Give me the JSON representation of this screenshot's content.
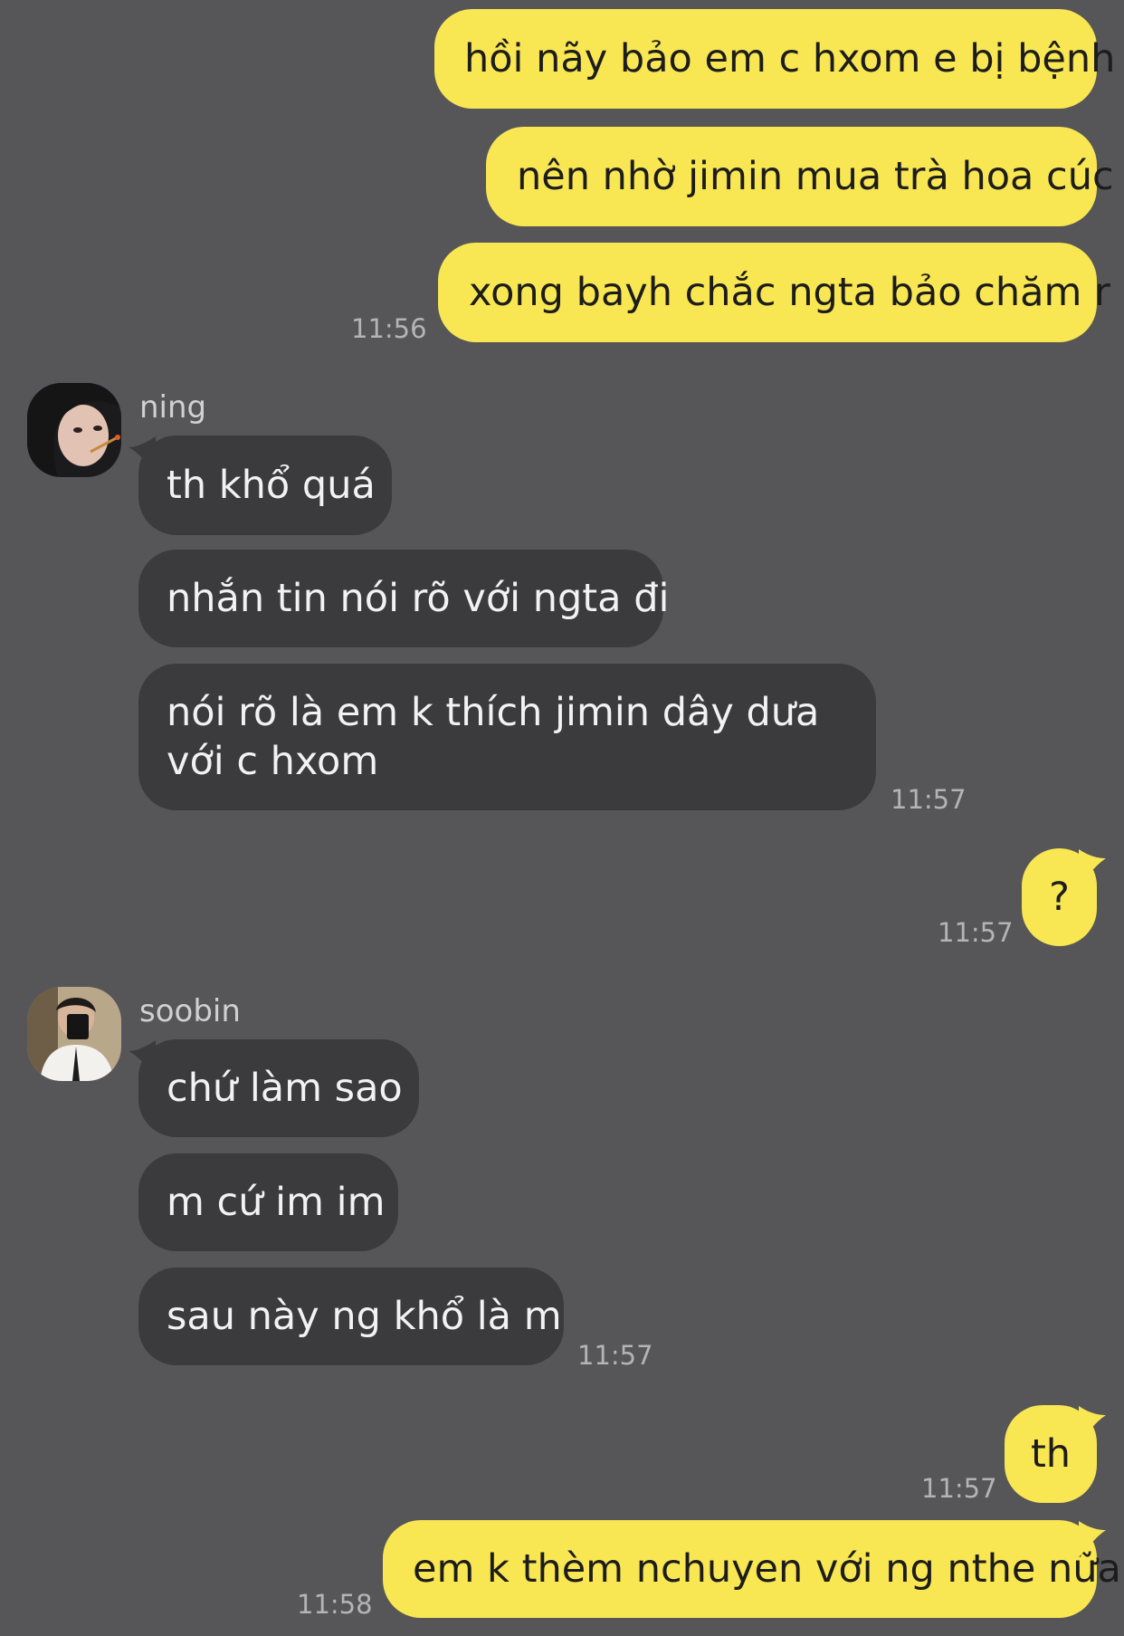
{
  "colors": {
    "background": "#565558",
    "outgoing_bubble": "#f8e652",
    "incoming_bubble": "#3b3a3d",
    "timestamp": "#b4b3b6"
  },
  "messages": {
    "m1": "hồi nãy bảo em c hxom e bị bệnh",
    "m2": "nên nhờ jimin mua trà hoa cúc",
    "m3": "xong bayh chắc ngta bảo chăm r",
    "t1": "11:56",
    "ning_name": "ning",
    "m4": "th khổ quá",
    "m5": "nhắn tin nói rõ với ngta đi",
    "m6": "nói rõ là em k thích jimin dây dưa với c hxom",
    "t2": "11:57",
    "m7": "?",
    "t3": "11:57",
    "soobin_name": "soobin",
    "m8": "chứ làm sao",
    "m9": "m cứ im im",
    "m10": "sau này ng khổ là m",
    "t4": "11:57",
    "m11": "th",
    "t5": "11:57",
    "m12": "em k thèm nchuyen với ng nthe nữa",
    "t6": "11:58"
  },
  "icons": {
    "ning_avatar": "profile-photo",
    "soobin_avatar": "profile-photo"
  }
}
